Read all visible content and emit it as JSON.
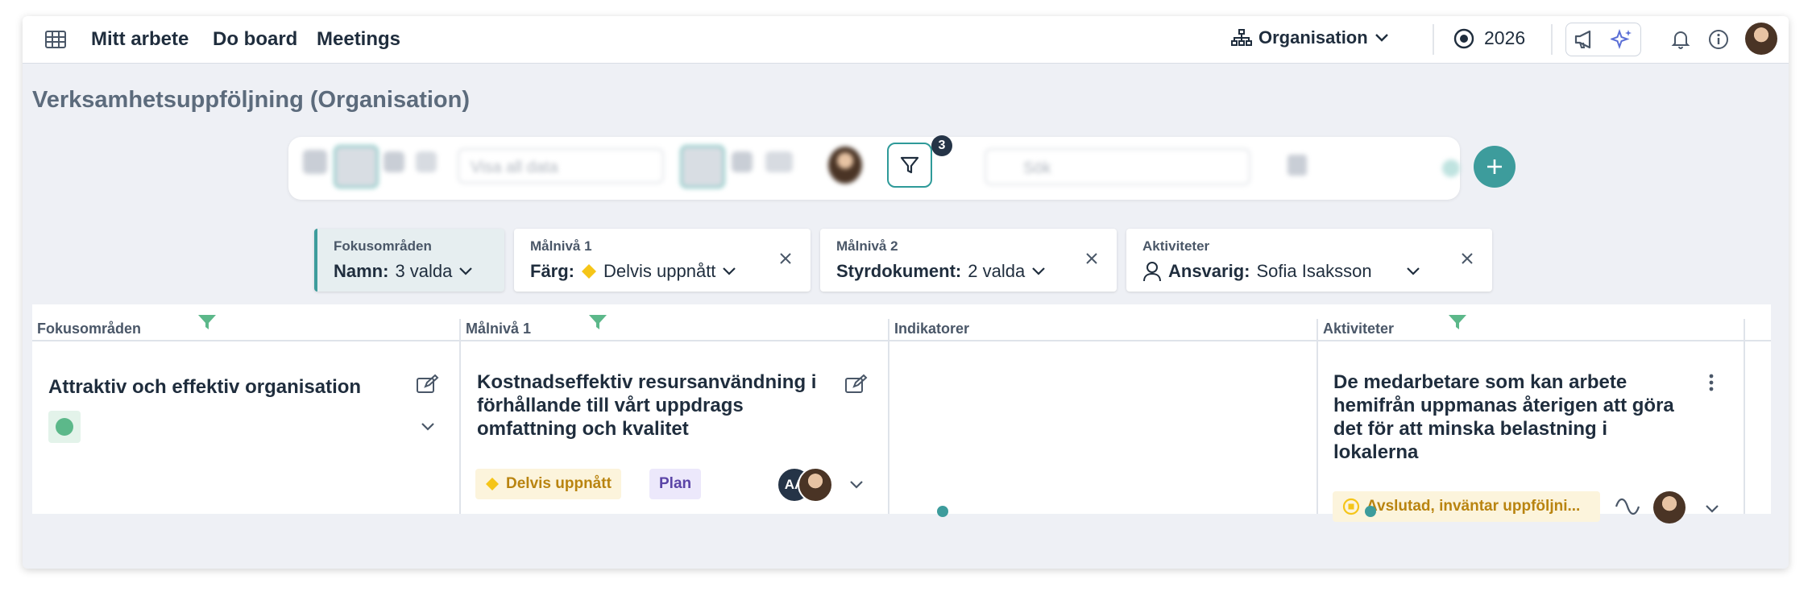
{
  "nav": {
    "items": [
      "Mitt arbete",
      "Do board",
      "Meetings"
    ],
    "org_label": "Organisation",
    "year": "2026"
  },
  "page": {
    "title": "Verksamhetsuppföljning (Organisation)"
  },
  "toolbar": {
    "filter_count": "3",
    "view_select": "Visa all data",
    "search_placeholder": "Sök"
  },
  "filters": [
    {
      "title": "Fokusområden",
      "key": "Namn:",
      "value": "3 valda"
    },
    {
      "title": "Målnivå 1",
      "key": "Färg:",
      "value": "Delvis uppnått"
    },
    {
      "title": "Målnivå 2",
      "key": "Styrdokument:",
      "value": "2 valda"
    },
    {
      "title": "Aktiviteter",
      "key": "Ansvarig:",
      "value": "Sofia Isaksson"
    }
  ],
  "columns": [
    "Fokusområden",
    "Målnivå 1",
    "Indikatorer",
    "Aktiviteter"
  ],
  "cards": {
    "fokus": {
      "title": "Attraktiv och effektiv organisation"
    },
    "malniva1": {
      "title_lines": [
        "Kostnadseffektiv resursanvändning i",
        "förhållande till vårt uppdrags",
        "omfattning och kvalitet"
      ],
      "status_tag": "Delvis uppnått",
      "type_tag": "Plan",
      "avatar_initials": "AA"
    },
    "aktivitet": {
      "title_lines": [
        "De medarbetare som kan arbete",
        "hemifrån uppmanas återigen att göra",
        "det för att minska belastning i",
        "lokalerna"
      ],
      "status_tag": "Avslutad, inväntar uppföljni..."
    }
  },
  "colors": {
    "accent": "#3d9c9c",
    "status_green": "#5cb88a",
    "status_yellow": "#f5c518",
    "dark": "#253447"
  }
}
